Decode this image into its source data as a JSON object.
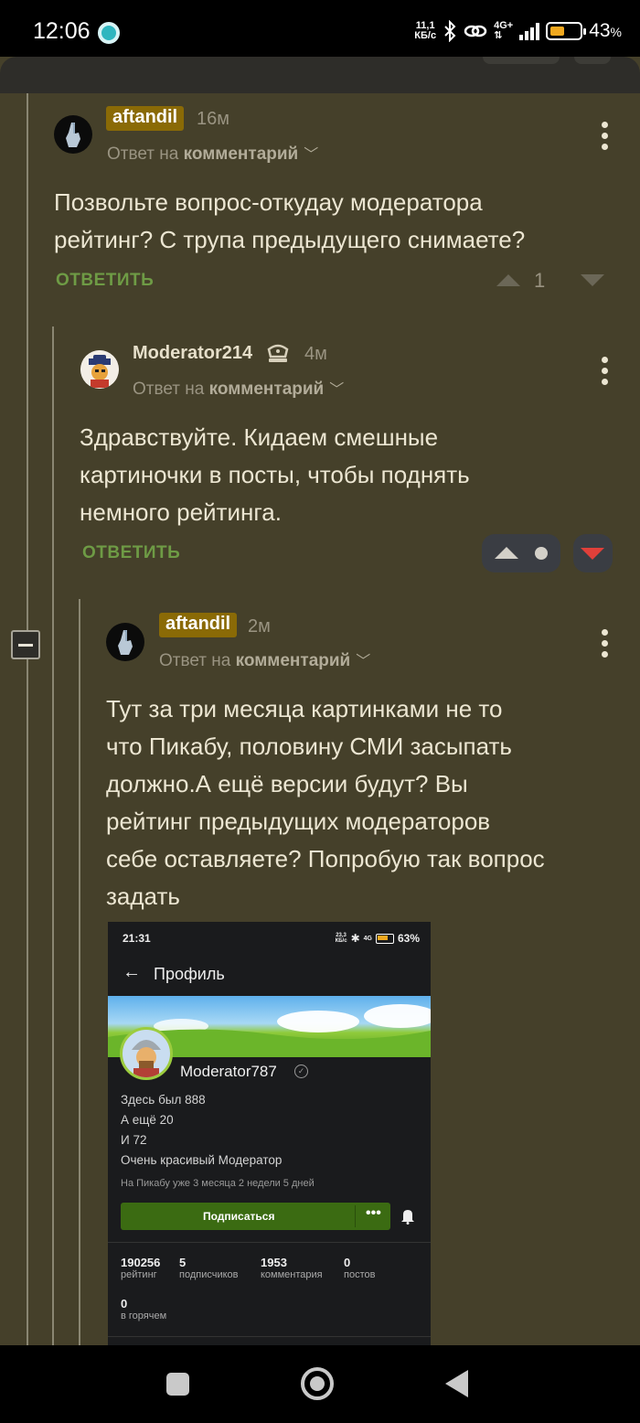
{
  "status_bar": {
    "time": "12:06",
    "net_speed": "11,1",
    "net_unit": "КБ/с",
    "network": "4G+",
    "battery": "43",
    "battery_unit": "%"
  },
  "comments": [
    {
      "user": "aftandil",
      "time": "16м",
      "reply_prefix": "Ответ на",
      "reply_link": "комментарий",
      "lines": [
        "Позвольте вопрос-откудау модератора",
        "рейтинг? С трупа предыдущего снимаете?"
      ],
      "reply_button": "ОТВЕТИТЬ",
      "rating": "1"
    },
    {
      "user": "Moderator214",
      "time": "4м",
      "reply_prefix": "Ответ на",
      "reply_link": "комментарий",
      "lines": [
        "Здравствуйте. Кидаем смешные",
        "картиночки в посты, чтобы поднять",
        "немного рейтинга."
      ],
      "reply_button": "ОТВЕТИТЬ"
    },
    {
      "user": "aftandil",
      "time": "2м",
      "reply_prefix": "Ответ на",
      "reply_link": "комментарий",
      "lines": [
        "Тут за три месяца картинками не то",
        "что Пикабу, половину СМИ засыпать",
        "должно.А ещё версии будут? Вы",
        "рейтинг предыдущих модераторов",
        "себе оставляете? Попробую так вопрос",
        "задать"
      ]
    }
  ],
  "screenshot": {
    "time": "21:31",
    "net": "23,3",
    "net_unit": "КБ/с",
    "battery": "63%",
    "header_title": "Профиль",
    "username": "Moderator787",
    "bio": [
      "Здесь был 888",
      "А ещё 20",
      "И 72",
      "Очень красивый Модератор"
    ],
    "since": "На Пикабу уже 3 месяца 2 недели 5 дней",
    "subscribe": "Подписаться",
    "stats": [
      {
        "value": "190256",
        "label": "рейтинг"
      },
      {
        "value": "5",
        "label": "подписчиков"
      },
      {
        "value": "1953",
        "label": "комментария"
      },
      {
        "value": "0",
        "label": "постов"
      },
      {
        "value": "0",
        "label": "в горячем"
      }
    ]
  },
  "colors": {
    "background": "#45402a",
    "badge": "#8a6a06",
    "reply": "#6e9b45",
    "downvote_active": "#e0403a",
    "subscribe": "#3b6b12"
  }
}
